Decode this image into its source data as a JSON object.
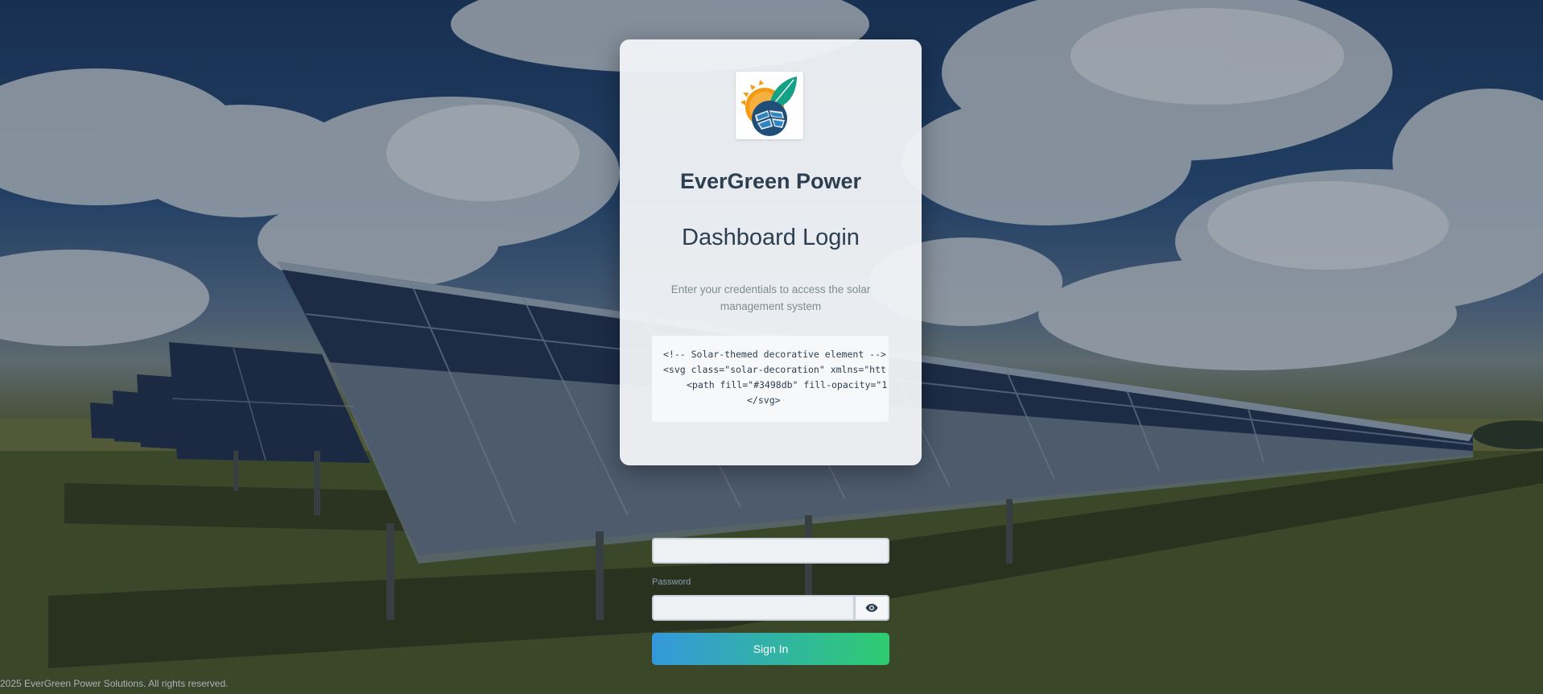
{
  "brand": {
    "name": "EverGreen Power"
  },
  "login": {
    "title": "Dashboard Login",
    "subtitle": "Enter your credentials to access the solar management system",
    "code_lines": [
      "<!-- Solar-themed decorative element -->",
      "<svg class=\"solar-decoration\" xmlns=\"htt",
      "<path fill=\"#3498db\" fill-opacity=\"1",
      "</svg>"
    ],
    "password_label": "Password",
    "signin_label": "Sign In"
  },
  "footer": {
    "text": "2025 EverGreen Power Solutions. All rights reserved."
  },
  "icons": {
    "logo": "solar-leaf-logo",
    "password_toggle": "eye-icon"
  },
  "colors": {
    "primary_text": "#2c3e50",
    "muted_text": "#7f8c8d",
    "button_gradient_start": "#3498db",
    "button_gradient_end": "#2ecc71",
    "logo_teal": "#16a085",
    "logo_orange": "#f39c12",
    "logo_navy": "#1f4e79"
  }
}
